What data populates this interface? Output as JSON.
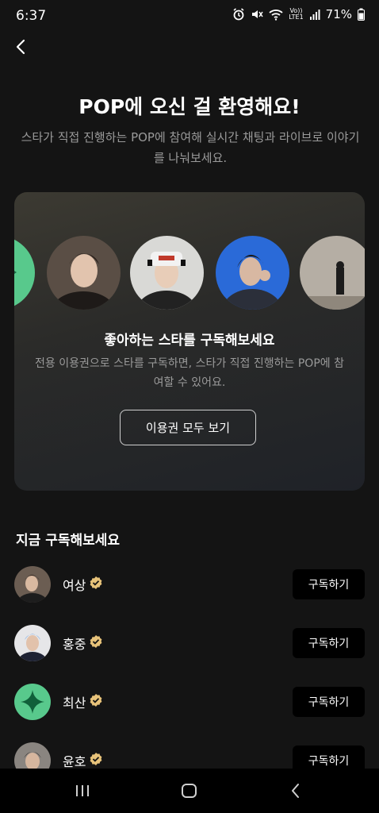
{
  "status": {
    "time": "6:37",
    "network_label_top": "Vo))",
    "network_label_bottom": "LTE1",
    "battery": "71%",
    "icons": [
      "alarm-icon",
      "mute-icon",
      "wifi-icon",
      "signal-icon",
      "battery-icon"
    ]
  },
  "header": {
    "back_icon": "back-chevron-icon",
    "title": "POP에 오신 걸 환영해요!",
    "subtitle": "스타가 직접 진행하는 POP에 참여해 실시간 채팅과 라이브로 이야기를 나눠보세요."
  },
  "promo_card": {
    "heading": "좋아하는 스타를 구독해보세요",
    "description": "전용 이용권으로 스타를 구독하면, 스타가 직접 진행하는 POP에 참여할 수 있어요.",
    "button_label": "이용권 모두 보기"
  },
  "subscribe_section": {
    "title": "지금 구독해보세요",
    "items": [
      {
        "name": "여상",
        "button": "구독하기"
      },
      {
        "name": "홍중",
        "button": "구독하기"
      },
      {
        "name": "최산",
        "button": "구독하기"
      },
      {
        "name": "윤호",
        "button": "구독하기"
      }
    ]
  },
  "colors": {
    "background": "#141414",
    "verified_badge": "#e8c37a",
    "accent_green": "#58c98c",
    "card_gradient_start": "#3c3a32",
    "card_gradient_end": "#1f2228"
  },
  "navbar": {
    "icons": [
      "recent-apps-icon",
      "home-icon",
      "back-icon"
    ]
  }
}
